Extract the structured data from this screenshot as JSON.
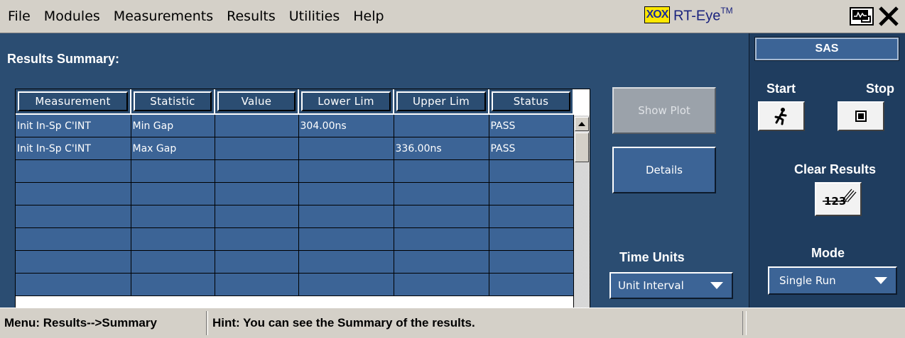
{
  "menubar": {
    "items": [
      "File",
      "Modules",
      "Measurements",
      "Results",
      "Utilities",
      "Help"
    ],
    "logo_text": "XOX",
    "app_title": "RT-Eye",
    "app_title_mark": "TM"
  },
  "results": {
    "title": "Results Summary:",
    "columns": [
      "Measurement",
      "Statistic",
      "Value",
      "Lower Lim",
      "Upper Lim",
      "Status"
    ],
    "rows": [
      [
        "Init In-Sp C'INT",
        "Min Gap",
        "",
        "304.00ns",
        "",
        "PASS"
      ],
      [
        "Init In-Sp C'INT",
        "Max Gap",
        "",
        "",
        "336.00ns",
        "PASS"
      ],
      [
        "",
        "",
        "",
        "",
        "",
        ""
      ],
      [
        "",
        "",
        "",
        "",
        "",
        ""
      ],
      [
        "",
        "",
        "",
        "",
        "",
        ""
      ],
      [
        "",
        "",
        "",
        "",
        "",
        ""
      ],
      [
        "",
        "",
        "",
        "",
        "",
        ""
      ],
      [
        "",
        "",
        "",
        "",
        "",
        ""
      ]
    ]
  },
  "actions": {
    "show_plot": "Show Plot",
    "details": "Details",
    "time_units_label": "Time Units",
    "time_units_value": "Unit Interval"
  },
  "right_panel": {
    "module": "SAS",
    "start_label": "Start",
    "stop_label": "Stop",
    "clear_label": "Clear Results",
    "clear_icon_text": "123",
    "mode_label": "Mode",
    "mode_value": "Single Run"
  },
  "statusbar": {
    "menu": "Menu: Results-->Summary",
    "hint": "Hint: You can see the Summary of the results."
  },
  "colors": {
    "panel_bg": "#2b4d72",
    "cell_bg": "#3c6496",
    "right_panel_bg": "#1f3d5f",
    "logo_bg": "#ffe800"
  }
}
